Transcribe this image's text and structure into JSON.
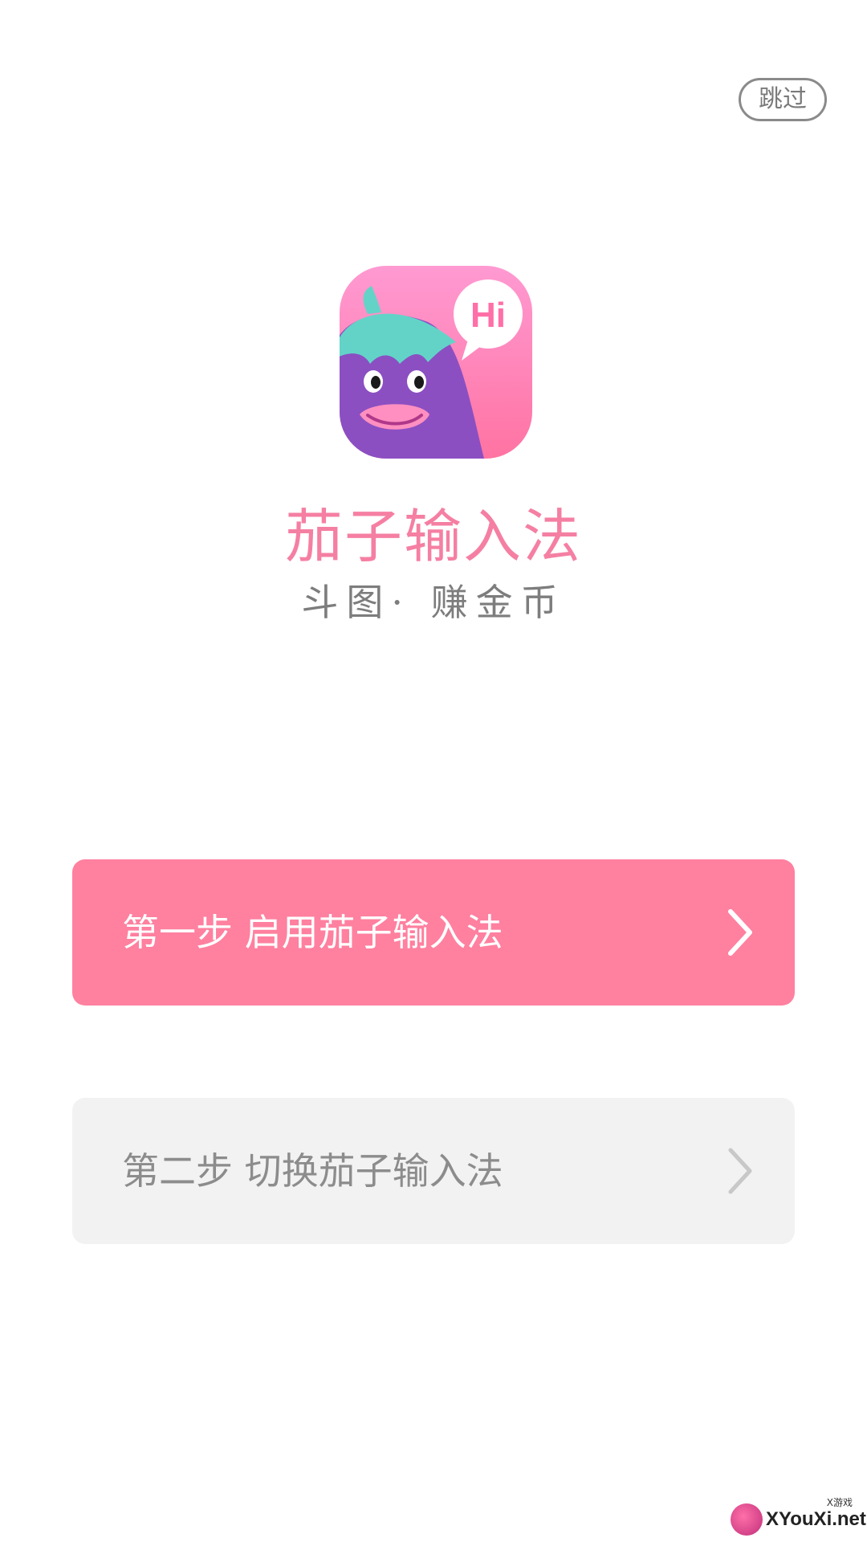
{
  "header": {
    "skip_label": "跳过"
  },
  "brand": {
    "app_name": "茄子输入法",
    "slogan": "斗图· 赚金币",
    "icon_bubble_text": "Hi",
    "colors": {
      "primary_pink": "#ff809f",
      "title_pink": "#f57fa3",
      "eggplant_purple": "#8b4fc2",
      "leaf_teal": "#63d3c8"
    }
  },
  "steps": [
    {
      "label": "第一步 启用茄子输入法",
      "state": "active",
      "icon": "chevron-right-icon"
    },
    {
      "label": "第二步 切换茄子输入法",
      "state": "disabled",
      "icon": "chevron-right-icon"
    }
  ],
  "watermark": {
    "small_text": "X游戏",
    "text": "XYouXi.net"
  }
}
